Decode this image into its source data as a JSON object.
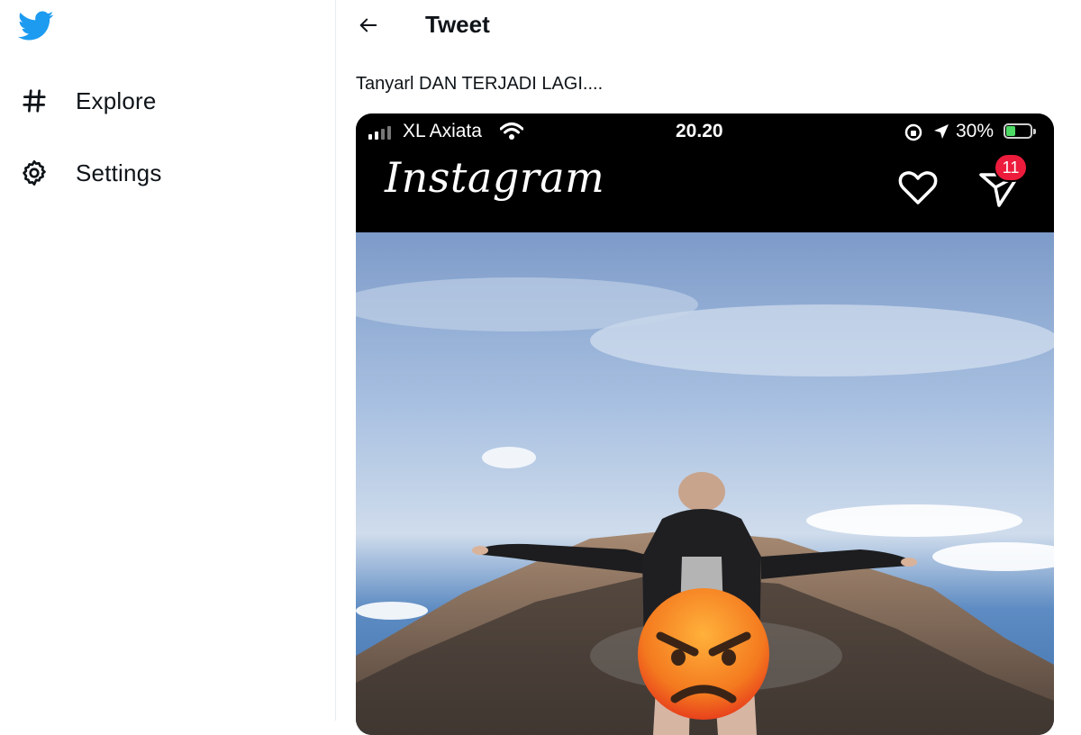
{
  "sidebar": {
    "logo_icon": "twitter-bird-icon",
    "items": [
      {
        "icon": "hashtag-icon",
        "label": "Explore"
      },
      {
        "icon": "gear-icon",
        "label": "Settings"
      }
    ]
  },
  "header": {
    "back_icon": "arrow-left-icon",
    "title": "Tweet"
  },
  "tweet": {
    "text": "Tanyarl DAN TERJADI LAGI...."
  },
  "media": {
    "status_bar": {
      "carrier": "XL Axiata",
      "time": "20.20",
      "battery": "30%"
    },
    "instagram": {
      "logo": "Instagram",
      "notification_count": "11"
    }
  },
  "colors": {
    "twitter_blue": "#1d9bf0",
    "badge_red": "#ed1c3c",
    "battery_green": "#4cd964"
  }
}
